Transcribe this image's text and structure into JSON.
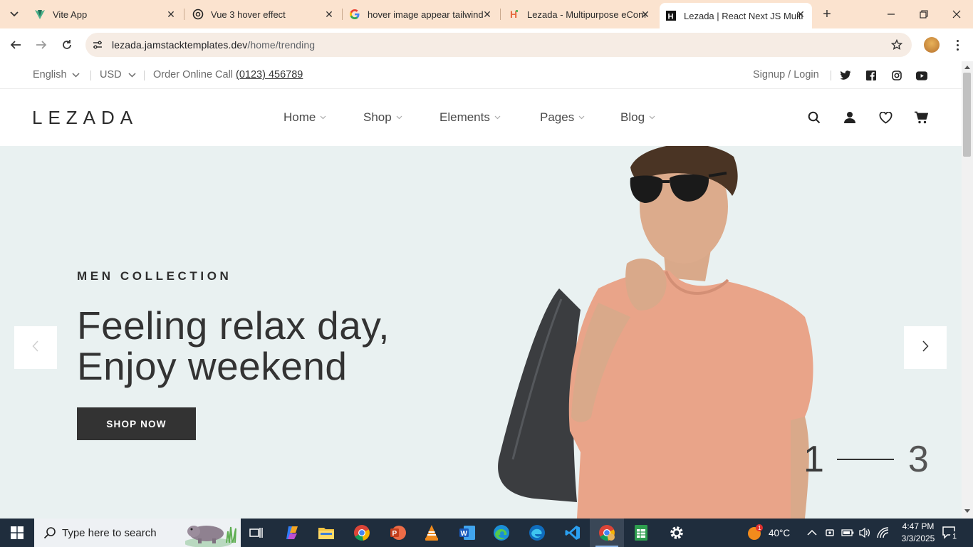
{
  "browser": {
    "tabs": [
      {
        "title": "Vite App",
        "icon": "vite-icon"
      },
      {
        "title": "Vue 3 hover effect",
        "icon": "chatgpt-icon"
      },
      {
        "title": "hover image appear tailwind",
        "icon": "google-icon"
      },
      {
        "title": "Lezada - Multipurpose eCom",
        "icon": "lezada-h-icon"
      },
      {
        "title": "Lezada | React Next JS Multi",
        "icon": "lezada-h-icon",
        "active": true
      }
    ],
    "url_host": "lezada.jamstacktemplates.dev",
    "url_path": "/home/trending"
  },
  "topbar": {
    "language": "English",
    "currency": "USD",
    "order_text": "Order Online Call",
    "phone": "(0123) 456789",
    "auth": "Signup / Login",
    "social": [
      "twitter-icon",
      "facebook-icon",
      "instagram-icon",
      "youtube-icon"
    ]
  },
  "header": {
    "logo": "LEZADA",
    "menu": [
      "Home",
      "Shop",
      "Elements",
      "Pages",
      "Blog"
    ],
    "icons": [
      "search-icon",
      "user-icon",
      "heart-icon",
      "cart-icon"
    ]
  },
  "hero": {
    "eyebrow": "MEN COLLECTION",
    "headline_line1": "Feeling relax day,",
    "headline_line2": "Enjoy weekend",
    "cta": "SHOP NOW",
    "slide_current": "1",
    "slide_total": "3",
    "background": "#e9f1f1",
    "shirt_color": "#e9a489"
  },
  "taskbar": {
    "search_placeholder": "Type here to search",
    "apps": [
      "task-view-icon",
      "copilot-icon",
      "file-explorer-icon",
      "chrome-icon",
      "powerpoint-icon",
      "vlc-icon",
      "word-icon",
      "edge-icon",
      "edge-dev-icon",
      "vscode-icon",
      "chrome-profile-icon",
      "sheets-icon",
      "settings-icon"
    ],
    "weather": "40°C",
    "weather_badge": "1",
    "time": "4:47 PM",
    "date": "3/3/2025",
    "notification_count": "1"
  }
}
